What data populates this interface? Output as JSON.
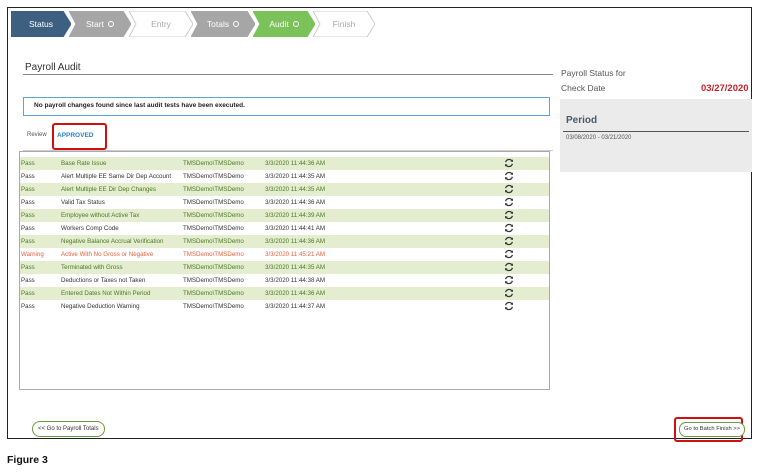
{
  "wizard": {
    "steps": [
      {
        "label": "Status",
        "state": "status"
      },
      {
        "label": "Start",
        "state": "done"
      },
      {
        "label": "Entry",
        "state": "inactive"
      },
      {
        "label": "Totals",
        "state": "done"
      },
      {
        "label": "Audit",
        "state": "active"
      },
      {
        "label": "Finish",
        "state": "inactive"
      }
    ]
  },
  "audit": {
    "title": "Payroll Audit",
    "notice": "No payroll changes found since last audit tests have been executed.",
    "tabs": {
      "review": "Review",
      "approved": "APPROVED"
    },
    "rows": [
      {
        "status": "Pass",
        "test": "Base Rate Issue",
        "user": "TMSDemo\\TMSDemo",
        "date": "3/3/2020 11:44:36 AM"
      },
      {
        "status": "Pass",
        "test": "Alert Multiple EE Same Dir Dep Account",
        "user": "TMSDemo\\TMSDemo",
        "date": "3/3/2020 11:44:35 AM"
      },
      {
        "status": "Pass",
        "test": "Alert Multiple EE Dir Dep Changes",
        "user": "TMSDemo\\TMSDemo",
        "date": "3/3/2020 11:44:35 AM"
      },
      {
        "status": "Pass",
        "test": "Valid Tax Status",
        "user": "TMSDemo\\TMSDemo",
        "date": "3/3/2020 11:44:36 AM"
      },
      {
        "status": "Pass",
        "test": "Employee without Active Tax",
        "user": "TMSDemo\\TMSDemo",
        "date": "3/3/2020 11:44:39 AM"
      },
      {
        "status": "Pass",
        "test": "Workers Comp Code",
        "user": "TMSDemo\\TMSDemo",
        "date": "3/3/2020 11:44:41 AM"
      },
      {
        "status": "Pass",
        "test": "Negative Balance Accrual Verification",
        "user": "TMSDemo\\TMSDemo",
        "date": "3/3/2020 11:44:36 AM"
      },
      {
        "status": "Warning",
        "test": "Active With No Gross or Negative",
        "user": "TMSDemo\\TMSDemo",
        "date": "3/3/2020 11:45:21 AM"
      },
      {
        "status": "Pass",
        "test": "Terminated with Gross",
        "user": "TMSDemo\\TMSDemo",
        "date": "3/3/2020 11:44:35 AM"
      },
      {
        "status": "Pass",
        "test": "Deductions or Taxes not Taken",
        "user": "TMSDemo\\TMSDemo",
        "date": "3/3/2020 11:44:38 AM"
      },
      {
        "status": "Pass",
        "test": "Entered Dates Not Within Period",
        "user": "TMSDemo\\TMSDemo",
        "date": "3/3/2020 11:44:36 AM"
      },
      {
        "status": "Pass",
        "test": "Negative Deduction Warning",
        "user": "TMSDemo\\TMSDemo",
        "date": "3/3/2020 11:44:37 AM"
      }
    ],
    "row_icon": "refresh-icon"
  },
  "footer": {
    "back_label": "<< Go to Payroll Totals",
    "finish_label": "Go to Batch Finish >>"
  },
  "right_panel": {
    "status_label": "Payroll Status for",
    "check_label": "Check Date",
    "check_date": "03/27/2020",
    "period_title": "Period",
    "period_value": "03/08/2020 - 03/21/2020"
  },
  "caption": "Figure 3",
  "colors": {
    "status_tab": "#3d5f80",
    "done_tab": "#a6a6a6",
    "active_tab": "#7cc25b",
    "pass_row_bg": "#e4edcf",
    "warning_text": "#e8603a",
    "highlight_red": "#d01010",
    "check_date": "#c8202a"
  }
}
